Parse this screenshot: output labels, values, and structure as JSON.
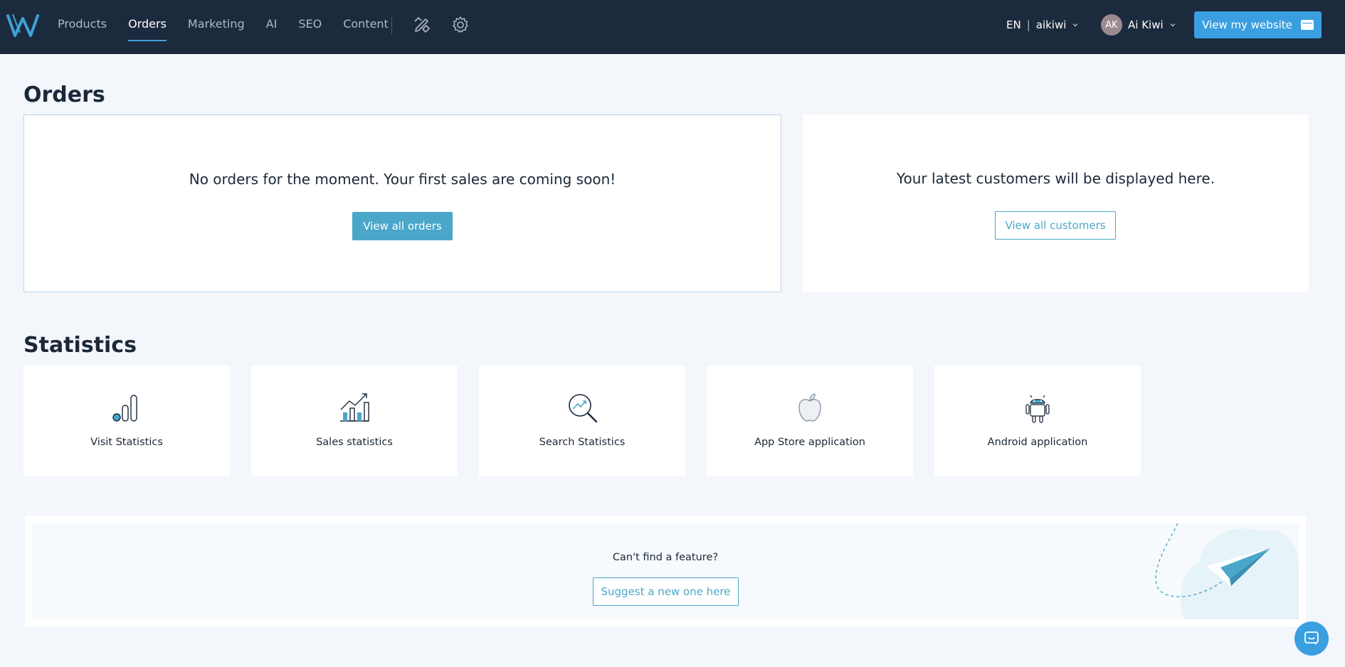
{
  "header": {
    "nav": [
      "Products",
      "Orders",
      "Marketing",
      "AI",
      "SEO",
      "Content"
    ],
    "active_nav": "Orders",
    "lang": "EN",
    "site": "aikiwi",
    "user_initials": "AK",
    "user_name": "Ai Kiwi",
    "view_site_label": "View my website"
  },
  "orders_section": {
    "title": "Orders",
    "orders_msg": "No orders for the moment. Your first sales are coming soon!",
    "orders_button": "View all orders",
    "customers_msg": "Your latest customers will be displayed here.",
    "customers_button": "View all customers"
  },
  "statistics_section": {
    "title": "Statistics",
    "items": [
      {
        "label": "Visit Statistics",
        "icon": "visit-statistics-icon"
      },
      {
        "label": "Sales statistics",
        "icon": "sales-statistics-icon"
      },
      {
        "label": "Search Statistics",
        "icon": "search-statistics-icon"
      },
      {
        "label": "App Store application",
        "icon": "apple-icon"
      },
      {
        "label": "Android application",
        "icon": "android-icon"
      }
    ]
  },
  "suggest": {
    "question": "Can't find a feature?",
    "button": "Suggest a new one here"
  },
  "colors": {
    "header_bg": "#1c2a3d",
    "accent": "#3a9fe0",
    "teal": "#4aa7c9",
    "page_bg": "#f3f6fa"
  }
}
